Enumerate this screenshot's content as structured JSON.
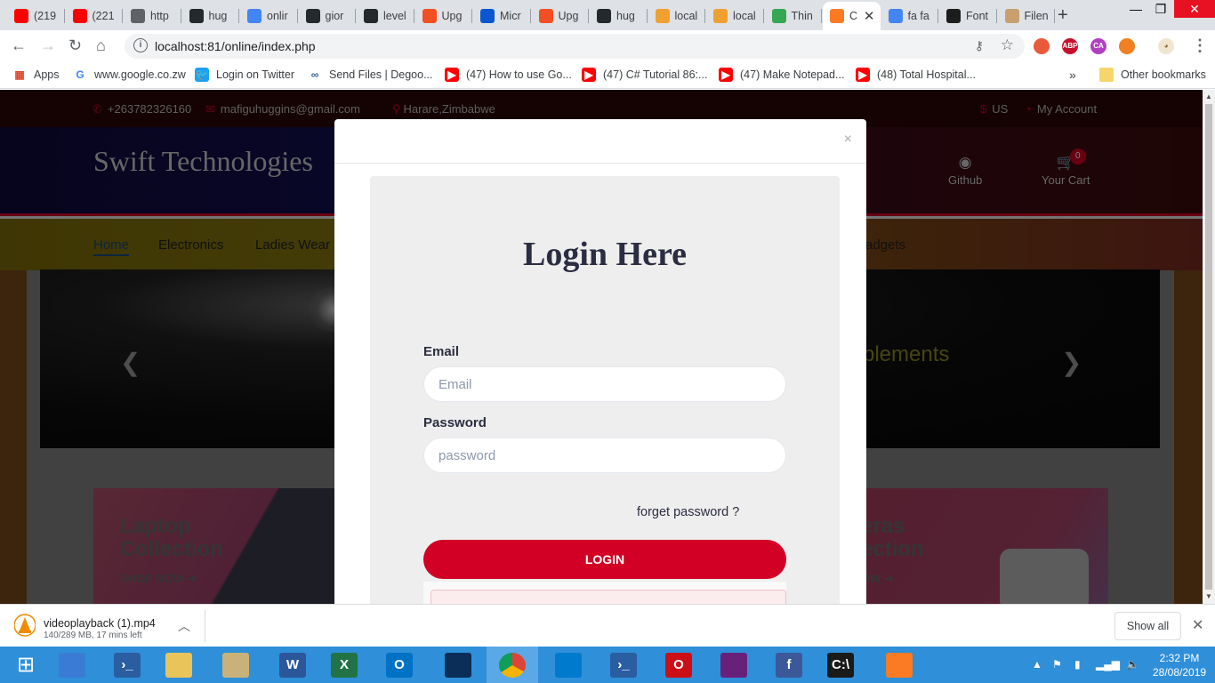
{
  "browser": {
    "tabs": [
      {
        "title": "(219",
        "icon": "youtube-icon",
        "color": "#ff0000"
      },
      {
        "title": "(221",
        "icon": "youtube-icon",
        "color": "#ff0000"
      },
      {
        "title": "http",
        "icon": "globe-icon",
        "color": "#5f6368"
      },
      {
        "title": "hug",
        "icon": "github-icon",
        "color": "#24292e"
      },
      {
        "title": "onlir",
        "icon": "google-icon",
        "color": "#4285f4"
      },
      {
        "title": "gior",
        "icon": "github-icon",
        "color": "#24292e"
      },
      {
        "title": "level",
        "icon": "github-icon",
        "color": "#24292e"
      },
      {
        "title": "Upg",
        "icon": "microsoft-icon",
        "color": "#f25022"
      },
      {
        "title": "Micr",
        "icon": "network-icon",
        "color": "#0b57d0"
      },
      {
        "title": "Upg",
        "icon": "microsoft-icon",
        "color": "#f25022"
      },
      {
        "title": "hug",
        "icon": "github-icon",
        "color": "#24292e"
      },
      {
        "title": "local",
        "icon": "phpmyadmin-icon",
        "color": "#f0a030"
      },
      {
        "title": "local",
        "icon": "phpmyadmin-icon",
        "color": "#f0a030"
      },
      {
        "title": "Thin",
        "icon": "page-icon",
        "color": "#34a853"
      },
      {
        "title": "C",
        "icon": "xampp-icon",
        "color": "#fb7a24"
      },
      {
        "title": "fa fa",
        "icon": "google-icon",
        "color": "#4285f4"
      },
      {
        "title": "Font",
        "icon": "fontawesome-icon",
        "color": "#1c1c1c"
      },
      {
        "title": "Filen",
        "icon": "sketch-icon",
        "color": "#c8a070"
      }
    ],
    "active_tab_index": 14,
    "url": "localhost:81/online/index.php",
    "bookmarks": [
      {
        "label": "Apps",
        "icon": "apps-grid-icon"
      },
      {
        "label": "www.google.co.zw",
        "icon": "google-icon"
      },
      {
        "label": "Login on Twitter",
        "icon": "twitter-icon"
      },
      {
        "label": "Send Files | Degoo...",
        "icon": "degoo-icon"
      },
      {
        "label": "(47) How to use Go...",
        "icon": "youtube-icon"
      },
      {
        "label": "(47) C# Tutorial 86:...",
        "icon": "youtube-icon"
      },
      {
        "label": "(47) Make Notepad...",
        "icon": "youtube-icon"
      },
      {
        "label": "(48) Total Hospital...",
        "icon": "youtube-icon"
      }
    ],
    "bookmarks_overflow": "»",
    "other_bookmarks": "Other bookmarks",
    "extensions": [
      {
        "label": "",
        "color": "#e85a3a",
        "icon": "ext-icon"
      },
      {
        "label": "ABP",
        "color": "#c8102e",
        "icon": "adblock-icon"
      },
      {
        "label": "CA",
        "color": "#b040c0",
        "icon": "ext-icon"
      },
      {
        "label": "",
        "color": "#f08020",
        "icon": "ext-icon"
      }
    ]
  },
  "site": {
    "topbar": {
      "phone": "+263782326160",
      "email": "mafiguhuggins@gmail.com",
      "location": "Harare,Zimbabwe",
      "currency": "US",
      "account": "My Account"
    },
    "brand": "Swift Technologies",
    "github_label": "Github",
    "cart_label": "Your Cart",
    "cart_qty": "0",
    "nav": [
      "Home",
      "Electronics",
      "Ladies Wear",
      "adgets"
    ],
    "slider_caption": "plements",
    "collections": [
      {
        "title_line1": "Laptop",
        "title_line2": "Collection",
        "cta": "SHOP NOW"
      },
      {
        "title_line1": "eras",
        "title_line2": "ection",
        "cta": "OW"
      }
    ]
  },
  "modal": {
    "close_glyph": "×",
    "title": "Login Here",
    "email_label": "Email",
    "email_placeholder": "Email",
    "email_value": "",
    "password_label": "Password",
    "password_placeholder": "password",
    "password_value": "",
    "forget": "forget password ?",
    "login_button": "LOGIN"
  },
  "download": {
    "filename": "videoplayback (1).mp4",
    "status": "140/289 MB, 17 mins left",
    "show_all": "Show all"
  },
  "taskbar": {
    "apps": [
      {
        "name": "start",
        "glyph": "⊞",
        "color": "#2f8fd8"
      },
      {
        "name": "file-explorer",
        "glyph": "",
        "color": "#3a7bd5"
      },
      {
        "name": "powershell",
        "glyph": "›_",
        "color": "#2a5ea0"
      },
      {
        "name": "folders",
        "glyph": "",
        "color": "#e9c45a"
      },
      {
        "name": "tools",
        "glyph": "",
        "color": "#c9b27a"
      },
      {
        "name": "word",
        "glyph": "W",
        "color": "#2b579a"
      },
      {
        "name": "excel",
        "glyph": "X",
        "color": "#217346"
      },
      {
        "name": "outlook",
        "glyph": "O",
        "color": "#0072c6"
      },
      {
        "name": "dynamics",
        "glyph": "",
        "color": "#0b2e59"
      },
      {
        "name": "chrome",
        "glyph": "",
        "color": "#4285f4"
      },
      {
        "name": "vscode",
        "glyph": "",
        "color": "#007acc"
      },
      {
        "name": "powershell-2",
        "glyph": "›_",
        "color": "#2a5ea0"
      },
      {
        "name": "opera",
        "glyph": "O",
        "color": "#cc0f16"
      },
      {
        "name": "visual-studio",
        "glyph": "",
        "color": "#68217a"
      },
      {
        "name": "facebook",
        "glyph": "f",
        "color": "#3b5998"
      },
      {
        "name": "cmd",
        "glyph": "C:\\",
        "color": "#1a1a1a"
      },
      {
        "name": "xampp",
        "glyph": "",
        "color": "#fb7a24"
      }
    ],
    "active_app_index": 9,
    "time": "2:32 PM",
    "date": "28/08/2019"
  }
}
